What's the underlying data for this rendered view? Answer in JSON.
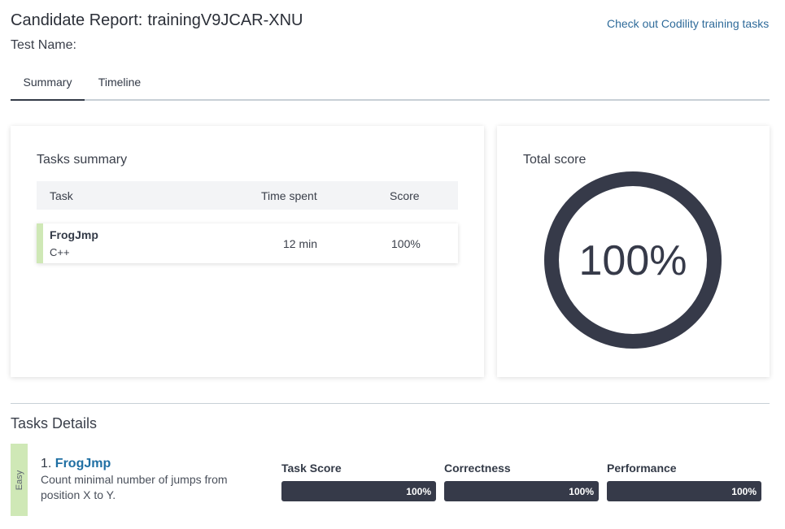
{
  "header": {
    "title_prefix": "Candidate Report:",
    "candidate_id": "trainingV9JCAR-XNU",
    "test_name_label": "Test Name:",
    "training_link": "Check out Codility training tasks"
  },
  "tabs": [
    {
      "label": "Summary",
      "active": true
    },
    {
      "label": "Timeline",
      "active": false
    }
  ],
  "tasks_summary": {
    "title": "Tasks summary",
    "columns": [
      "Task",
      "Time spent",
      "Score"
    ],
    "rows": [
      {
        "name": "FrogJmp",
        "language": "C++",
        "time_spent": "12 min",
        "score": "100%"
      }
    ]
  },
  "total_score": {
    "title": "Total score",
    "value_text": "100%",
    "value": 100
  },
  "tasks_details": {
    "title": "Tasks Details",
    "tasks": [
      {
        "difficulty": "Easy",
        "number": "1.",
        "name": "FrogJmp",
        "description": "Count minimal number of jumps from position X to Y.",
        "metrics": [
          {
            "label": "Task Score",
            "value_text": "100%",
            "value": 100
          },
          {
            "label": "Correctness",
            "value_text": "100%",
            "value": 100
          },
          {
            "label": "Performance",
            "value_text": "100%",
            "value": 100
          }
        ]
      }
    ]
  },
  "colors": {
    "dark": "#363a49",
    "link": "#1f6fa3",
    "easy": "#cfe8b6"
  }
}
